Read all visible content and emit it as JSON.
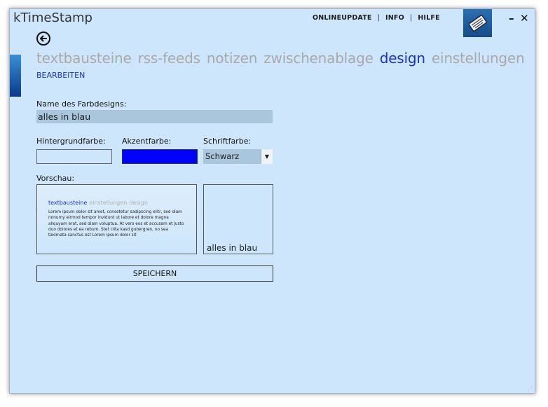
{
  "app": {
    "title": "kTimeStamp"
  },
  "topnav": {
    "onlineupdate": "ONLINEUPDATE",
    "info": "INFO",
    "hilfe": "HILFE",
    "separator": "|"
  },
  "window_controls": {
    "minimize": "–",
    "close": "✕"
  },
  "tabs": [
    {
      "label": "textbausteine"
    },
    {
      "label": "rss-feeds"
    },
    {
      "label": "notizen"
    },
    {
      "label": "zwischenablage"
    },
    {
      "label": "design",
      "active": true
    },
    {
      "label": "einstellungen"
    }
  ],
  "subtab": {
    "label": "BEARBEITEN"
  },
  "form": {
    "name_label": "Name des Farbdesigns:",
    "name_value": "alles in blau",
    "background_label": "Hintergrundfarbe:",
    "background_color": "#cde6fb",
    "accent_label": "Akzentfarbe:",
    "accent_color": "#0000ff",
    "font_label": "Schriftfarbe:",
    "font_value": "Schwarz",
    "preview_label": "Vorschau:"
  },
  "preview": {
    "tab_active": "textbausteine",
    "tab_2": "einstellungen",
    "tab_3": "design",
    "text": "Lorem ipsum dolor sit amet, consetetur sadipscing elitr, sed diam nonumy eirmod tempor invidunt ut labore et dolore magna aliquyam erat, sed diam voluptua. At vero eos et accusam et justo duo dolores et ea rebum. Stet clita kasd gubergren, no sea takimata sanctus est Lorem ipsum dolor sit",
    "name": "alles in blau"
  },
  "save_button": {
    "label": "SPEICHERN"
  },
  "colors": {
    "window_bg": "#cde6fb",
    "accent": "#1d33c4",
    "inactive_tab": "#a9a9a9"
  }
}
